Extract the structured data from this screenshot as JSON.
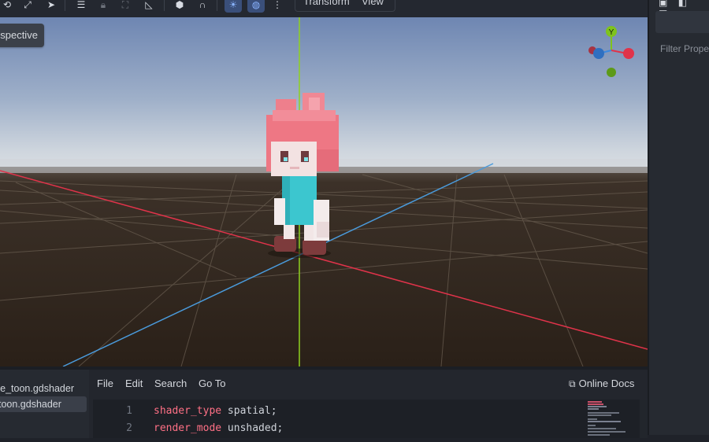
{
  "toolbar": {
    "icons": [
      "rotate-icon",
      "move-icon",
      "select-pointer-icon",
      "list-select-icon",
      "lock-icon",
      "group-icon",
      "ruler-icon",
      "cube-icon",
      "snap-icon",
      "sun-icon",
      "globe-icon",
      "more-icon"
    ],
    "menus": [
      "Transform",
      "View"
    ]
  },
  "viewport": {
    "view_mode_label": "Perspective",
    "gizmo": {
      "y_label": "Y",
      "x_color": "#e0334a",
      "y_color": "#7fc31c",
      "z_color": "#3a88e0"
    },
    "colors": {
      "x_axis": "#e0334a",
      "y_axis": "#8fd11f",
      "z_axis": "#4a9bdc",
      "sky_top": "#6e86b2",
      "horizon": "#d6dce3",
      "ground": "#2b2119"
    }
  },
  "right_dock": {
    "filter_placeholder": "Filter Properties"
  },
  "bottom_panel": {
    "files": [
      {
        "name": "cube_toon.gdshader",
        "selected": false
      },
      {
        "name": "toon.gdshader",
        "selected": true
      }
    ],
    "menu": [
      "File",
      "Edit",
      "Search",
      "Go To"
    ],
    "online_docs": "Online Docs",
    "code": [
      {
        "line": "1",
        "keyword": "shader_type",
        "value": "spatial;"
      },
      {
        "line": "2",
        "keyword": "render_mode",
        "value": "unshaded;"
      }
    ]
  }
}
